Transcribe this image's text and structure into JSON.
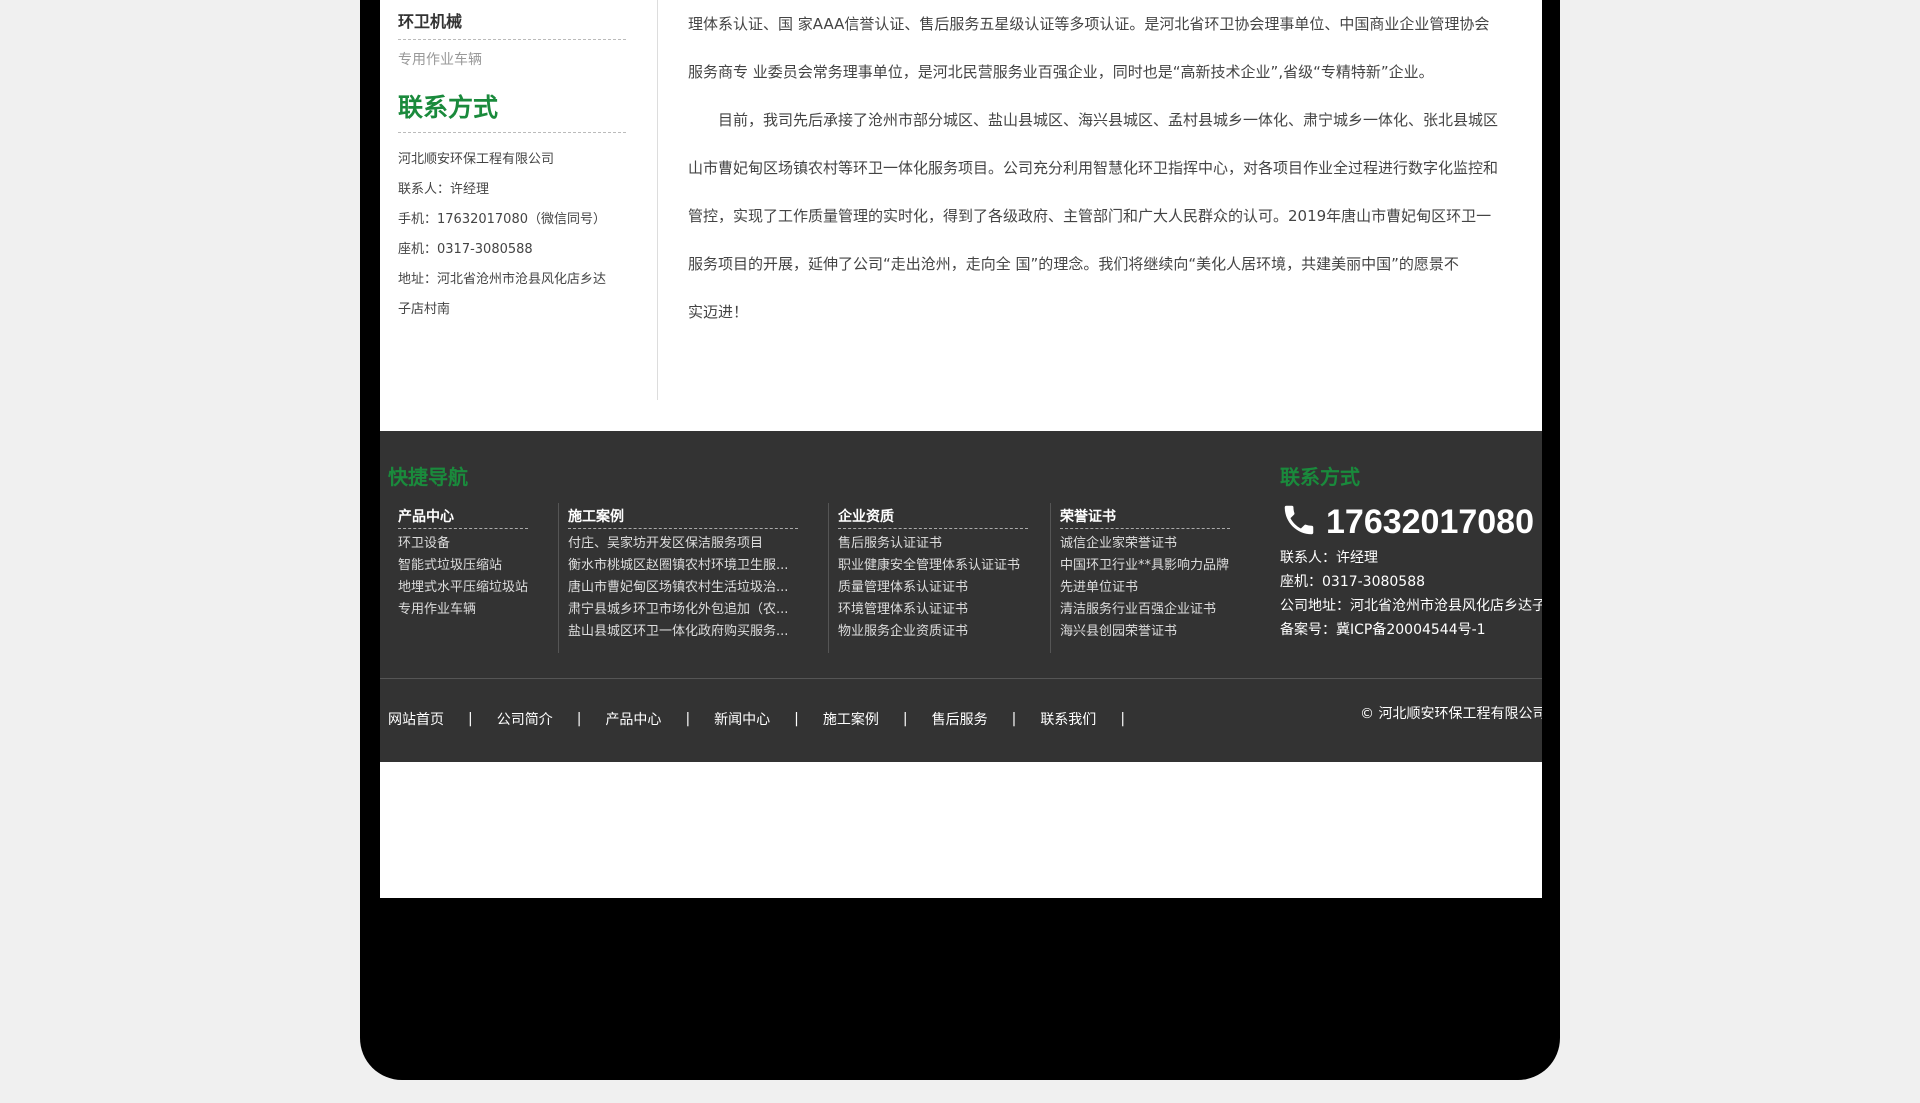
{
  "sidebar": {
    "category": "环卫机械",
    "sub_item": "专用作业车辆",
    "contact_title": "联系方式",
    "contact_lines": [
      "河北顺安环保工程有限公司",
      "联系人：许经理",
      "手机：17632017080（微信同号）",
      "座机：0317-3080588",
      "地址：河北省沧州市沧县风化店乡达",
      "子店村南"
    ]
  },
  "article": {
    "lines": [
      "理体系认证、国 家AAA信誉认证、售后服务五星级认证等多项认证。是河北省环卫协会理事单位、中国商业企业管理协会",
      "服务商专 业委员会常务理事单位，是河北民营服务业百强企业，同时也是“高新技术企业”,省级“专精特新”企业。",
      "　　目前，我司先后承接了沧州市部分城区、盐山县城区、海兴县城区、孟村县城乡一体化、肃宁城乡一体化、张北县城区",
      "山市曹妃甸区场镇农村等环卫一体化服务项目。公司充分利用智慧化环卫指挥中心，对各项目作业全过程进行数字化监控和",
      "管控，实现了工作质量管理的实时化，得到了各级政府、主管部门和广大人民群众的认可。2019年唐山市曹妃甸区环卫一",
      "服务项目的开展，延伸了公司“走出沧州，走向全 国”的理念。我们将继续向“美化人居环境，共建美丽中国”的愿景不",
      "实迈进！"
    ]
  },
  "footer": {
    "nav_title": "快捷导航",
    "contact_title": "联系方式",
    "columns": [
      {
        "head": "产品中心",
        "items": [
          "环卫设备",
          "智能式垃圾压缩站",
          "地埋式水平压缩垃圾站",
          "专用作业车辆"
        ]
      },
      {
        "head": "施工案例",
        "items": [
          "付庄、吴家坊开发区保洁服务项目",
          "衡水市桃城区赵圈镇农村环境卫生服...",
          "唐山市曹妃甸区场镇农村生活垃圾治...",
          "肃宁县城乡环卫市场化外包追加（农...",
          "盐山县城区环卫一体化政府购买服务..."
        ]
      },
      {
        "head": "企业资质",
        "items": [
          "售后服务认证证书",
          "职业健康安全管理体系认证证书",
          "质量管理体系认证证书",
          "环境管理体系认证证书",
          "物业服务企业资质证书"
        ]
      },
      {
        "head": "荣誉证书",
        "items": [
          "诚信企业家荣誉证书",
          "中国环卫行业**具影响力品牌",
          "先进单位证书",
          "清洁服务行业百强企业证书",
          "海兴县创园荣誉证书"
        ]
      }
    ],
    "phone": "17632017080",
    "info_lines": [
      "联系人：许经理",
      "座机：0317-3080588",
      "公司地址：河北省沧州市沧县风化店乡达子",
      "备案号：冀ICP备20004544号-1"
    ],
    "nav": [
      "网站首页",
      "公司简介",
      "产品中心",
      "新闻中心",
      "施工案例",
      "售后服务",
      "联系我们"
    ],
    "nav_separator": "|",
    "copyright": "© 河北顺安环保工程有限公司 版"
  },
  "colors": {
    "accent": "#1a8a3c",
    "footer_bg": "#333333",
    "device_frame": "#000000"
  },
  "icons": {
    "phone": "phone-icon"
  }
}
